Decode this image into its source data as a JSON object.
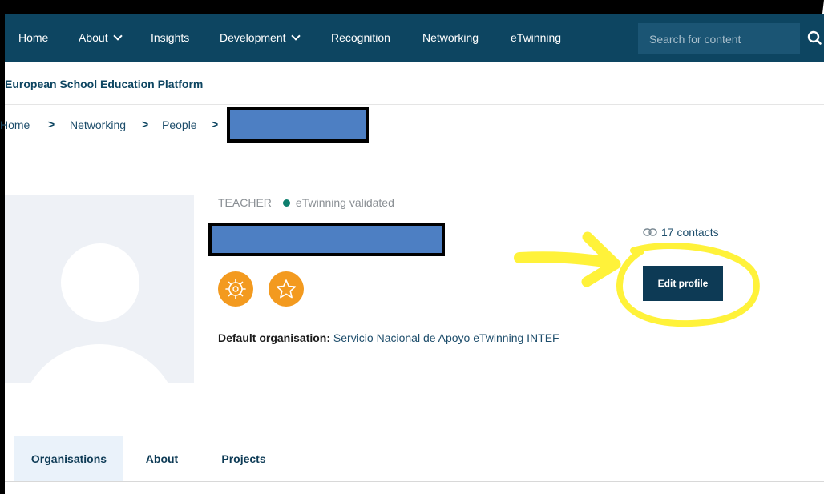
{
  "topnav": {
    "items": [
      {
        "label": "Home"
      },
      {
        "label": "About"
      },
      {
        "label": "Insights"
      },
      {
        "label": "Development"
      },
      {
        "label": "Recognition"
      },
      {
        "label": "Networking"
      },
      {
        "label": "eTwinning"
      }
    ],
    "search_placeholder": "Search for content",
    "background": "#0d4561"
  },
  "platform": {
    "title": "European School Education Platform"
  },
  "breadcrumb": {
    "items": [
      "Home",
      "Networking",
      "People"
    ],
    "separator": ">"
  },
  "profile": {
    "role": "TEACHER",
    "status": "eTwinning validated",
    "status_color": "#0e7f6e",
    "contacts": "17 contacts",
    "edit_label": "Edit profile",
    "org_label": "Default organisation:",
    "org_value": "Servicio Nacional de Apoyo eTwinning INTEF",
    "badges": [
      {
        "icon": "gear-badge-icon",
        "color": "#f39a1f"
      },
      {
        "icon": "star-badge-icon",
        "color": "#f39a1f"
      }
    ]
  },
  "tabs": {
    "items": [
      {
        "label": "Organisations",
        "active": true
      },
      {
        "label": "About"
      },
      {
        "label": "Projects"
      }
    ]
  },
  "annotation_color": "#fff23a"
}
